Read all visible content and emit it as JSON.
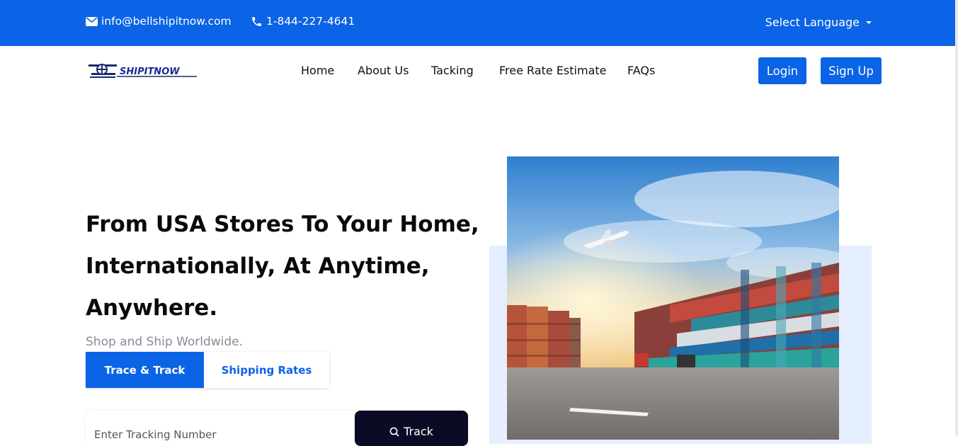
{
  "topbar": {
    "email": "info@bellshipitnow.com",
    "phone": "1-844-227-4641",
    "language_label": "Select Language"
  },
  "logo": {
    "text": "SHIPITNOW"
  },
  "nav": {
    "items": [
      "Home",
      "About Us",
      "Tacking",
      "Free Rate Estimate",
      "FAQs"
    ],
    "login": "Login",
    "signup": "Sign Up"
  },
  "hero": {
    "title_lines": [
      "From USA Stores To Your Home,",
      "Internationally, At Anytime,",
      "Anywhere."
    ],
    "subtitle": "Shop and Ship Worldwide.",
    "tabs": [
      "Trace & Track",
      "Shipping Rates"
    ],
    "tracking_placeholder": "Enter Tracking Number",
    "track_button": "Track"
  },
  "colors": {
    "brand": "#0b63e5",
    "dark_button": "#0a0c26",
    "image_backdrop": "#e5efff"
  }
}
